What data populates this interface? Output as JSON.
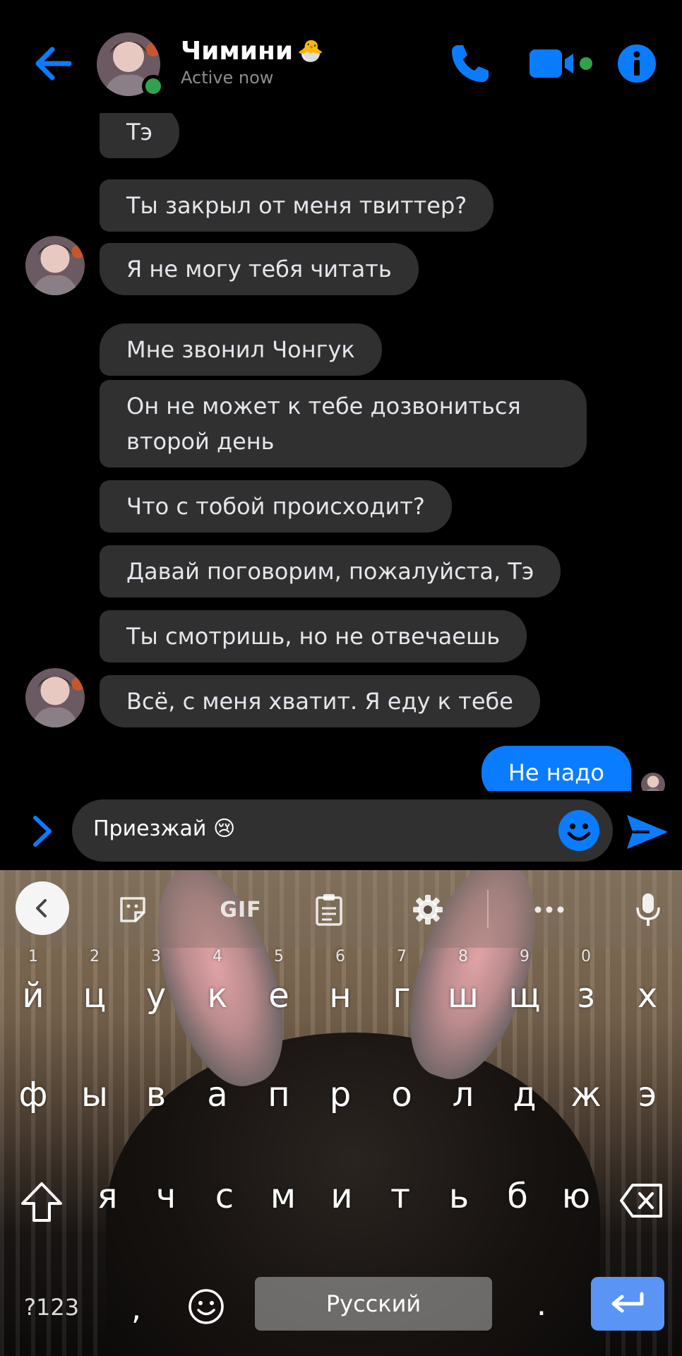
{
  "header": {
    "contact_name": "Чимини",
    "name_emoji": "🐣",
    "status": "Active now"
  },
  "messages": {
    "incoming": [
      {
        "text": "Тэ"
      },
      {
        "text": "Ты закрыл от меня твиттер?"
      },
      {
        "text": "Я не могу тебя читать"
      },
      {
        "text": "Мне звонил Чонгук"
      },
      {
        "text": "Он не может к тебе дозвониться второй день"
      },
      {
        "text": "Что с тобой происходит?"
      },
      {
        "text": "Давай поговорим, пожалуйста, Тэ"
      },
      {
        "text": "Ты смотришь, но не отвечаешь"
      },
      {
        "text": "Всё, с меня хватит. Я еду к тебе"
      }
    ],
    "outgoing": [
      {
        "text": "Не надо"
      }
    ]
  },
  "composer": {
    "input_value": "Приезжай 😢"
  },
  "keyboard": {
    "toolbar": {
      "gif_label": "GIF"
    },
    "row1": [
      {
        "key": "й",
        "hint": "1"
      },
      {
        "key": "ц",
        "hint": "2"
      },
      {
        "key": "у",
        "hint": "3"
      },
      {
        "key": "к",
        "hint": "4"
      },
      {
        "key": "е",
        "hint": "5"
      },
      {
        "key": "н",
        "hint": "6"
      },
      {
        "key": "г",
        "hint": "7"
      },
      {
        "key": "ш",
        "hint": "8"
      },
      {
        "key": "щ",
        "hint": "9"
      },
      {
        "key": "з",
        "hint": "0"
      },
      {
        "key": "х",
        "hint": ""
      }
    ],
    "row2": [
      "ф",
      "ы",
      "в",
      "а",
      "п",
      "р",
      "о",
      "л",
      "д",
      "ж",
      "э"
    ],
    "row3": [
      "я",
      "ч",
      "с",
      "м",
      "и",
      "т",
      "ь",
      "б",
      "ю"
    ],
    "symbols_label": "?123",
    "comma": ",",
    "space_label": "Русский",
    "period": "."
  },
  "colors": {
    "accent": "#0a7cff",
    "incoming_bubble": "#303030",
    "online": "#31a24c"
  }
}
